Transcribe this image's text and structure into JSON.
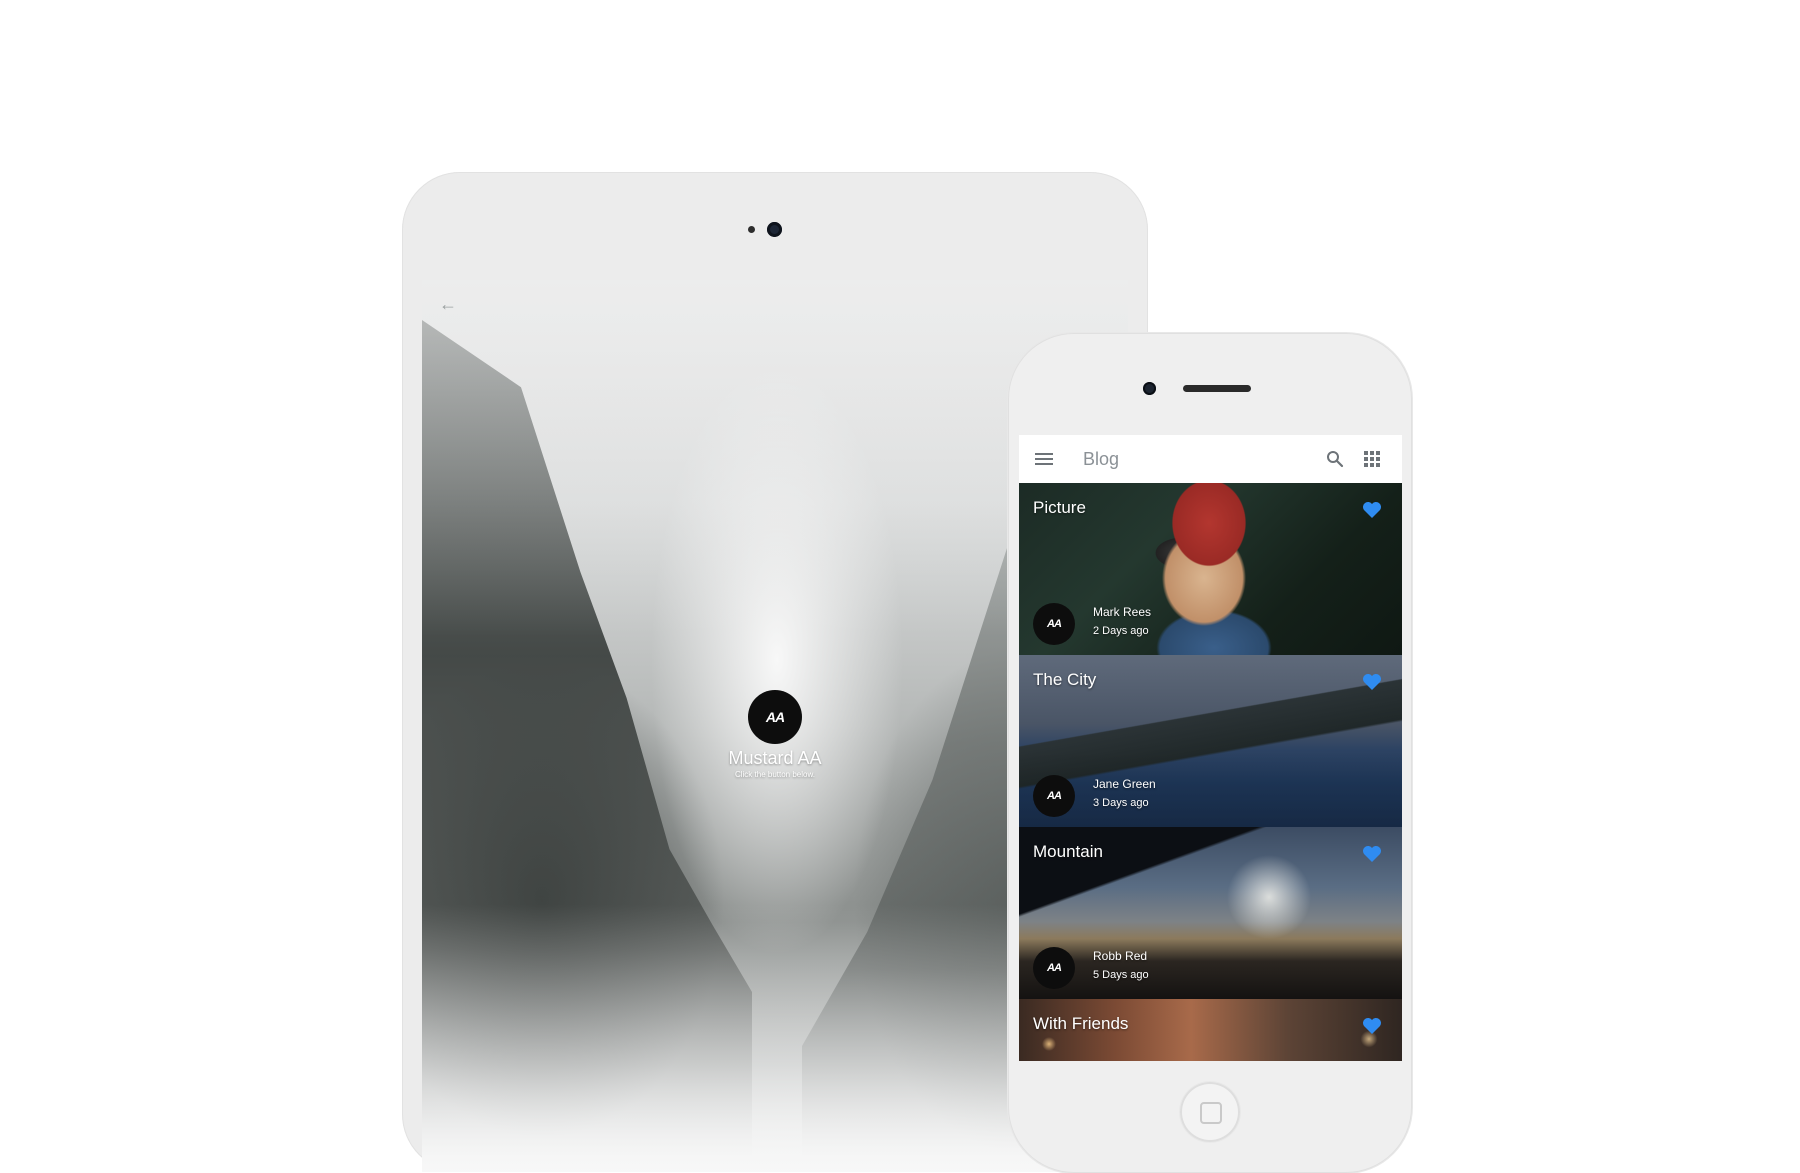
{
  "tablet": {
    "back_icon": "arrow-left-icon",
    "profile": {
      "logo_text": "AA",
      "name": "Mustard AA",
      "subtitle": "Click the button below."
    }
  },
  "phone": {
    "appbar": {
      "title": "Blog",
      "menu_icon": "menu-icon",
      "search_icon": "search-icon",
      "apps_icon": "grid-icon"
    },
    "cards": [
      {
        "title": "Picture",
        "author": "Mark Rees",
        "date": "2 Days ago",
        "avatar_text": "AA"
      },
      {
        "title": "The City",
        "author": "Jane Green",
        "date": "3 Days ago",
        "avatar_text": "AA"
      },
      {
        "title": "Mountain",
        "author": "Robb Red",
        "date": "5 Days ago",
        "avatar_text": "AA"
      },
      {
        "title": "With Friends"
      }
    ],
    "favorite_color": "#2f8cf1"
  }
}
